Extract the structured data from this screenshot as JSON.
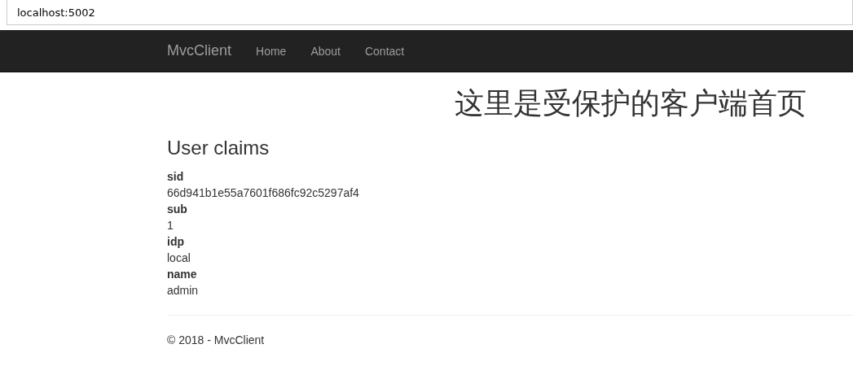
{
  "address_bar": {
    "url": "localhost:5002"
  },
  "navbar": {
    "brand": "MvcClient",
    "links": [
      "Home",
      "About",
      "Contact"
    ]
  },
  "page_heading": "这里是受保护的客户端首页",
  "section_title": "User claims",
  "claims": [
    {
      "type": "sid",
      "value": "66d941b1e55a7601f686fc92c5297af4"
    },
    {
      "type": "sub",
      "value": "1"
    },
    {
      "type": "idp",
      "value": "local"
    },
    {
      "type": "name",
      "value": "admin"
    }
  ],
  "footer": "© 2018 - MvcClient"
}
